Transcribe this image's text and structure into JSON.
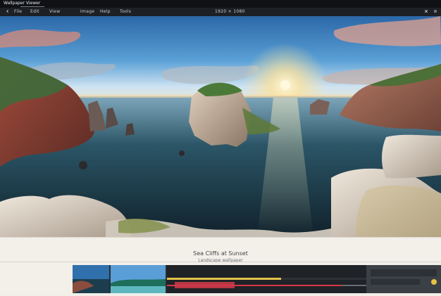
{
  "app": {
    "title": "Wallpaper Viewer"
  },
  "toolbar": {
    "items": [
      "File",
      "Edit",
      "View",
      "Image",
      "Help",
      "Tools"
    ],
    "center_label": "1920 × 1080"
  },
  "caption": {
    "title": "Sea Cliffs at Sunset",
    "subtitle": "Landscape wallpaper"
  },
  "colors": {
    "accent": "#e3c24a",
    "progress_red": "#d5394a",
    "toolbar_bg": "#1d2025"
  },
  "timeline": {
    "progress": 0.42
  }
}
